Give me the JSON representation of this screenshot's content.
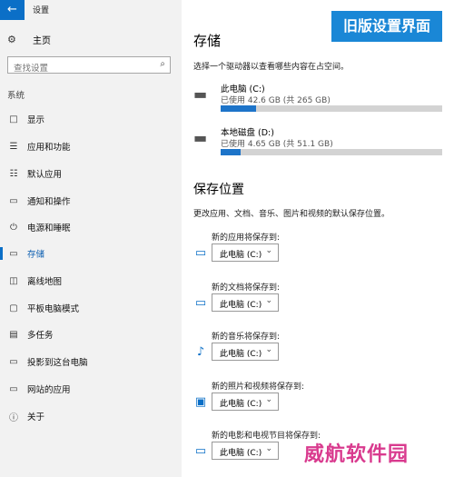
{
  "window": {
    "back_icon": "←",
    "title": "设置"
  },
  "sidebar": {
    "home": {
      "icon": "⚙",
      "label": "主页"
    },
    "search": {
      "placeholder": "查找设置",
      "icon": "⌕"
    },
    "section_label": "系统",
    "items": [
      {
        "icon": "□",
        "label": "显示"
      },
      {
        "icon": "☰",
        "label": "应用和功能"
      },
      {
        "icon": "☷",
        "label": "默认应用"
      },
      {
        "icon": "▭",
        "label": "通知和操作"
      },
      {
        "icon": "⏻",
        "label": "电源和睡眠"
      },
      {
        "icon": "▭",
        "label": "存储"
      },
      {
        "icon": "◫",
        "label": "离线地图"
      },
      {
        "icon": "▢",
        "label": "平板电脑模式"
      },
      {
        "icon": "▤",
        "label": "多任务"
      },
      {
        "icon": "▭",
        "label": "投影到这台电脑"
      },
      {
        "icon": "▭",
        "label": "网站的应用"
      },
      {
        "icon": "ⓘ",
        "label": "关于"
      }
    ],
    "active_index": 5
  },
  "main": {
    "storage": {
      "title": "存储",
      "description": "选择一个驱动器以查看哪些内容在占空间。",
      "drives": [
        {
          "icon": "▬",
          "name": "此电脑 (C:)",
          "usage": "已使用 42.6 GB (共 265 GB)",
          "fraction_used": 0.161
        },
        {
          "icon": "▬",
          "name": "本地磁盘 (D:)",
          "usage": "已使用 4.65 GB (共 51.1 GB)",
          "fraction_used": 0.091
        }
      ]
    },
    "save_locations": {
      "title": "保存位置",
      "description": "更改应用、文档、音乐、图片和视频的默认保存位置。",
      "items": [
        {
          "icon": "▭",
          "label": "新的应用将保存到:",
          "value": "此电脑 (C:)"
        },
        {
          "icon": "▭",
          "label": "新的文档将保存到:",
          "value": "此电脑 (C:)"
        },
        {
          "icon": "♪",
          "label": "新的音乐将保存到:",
          "value": "此电脑 (C:)"
        },
        {
          "icon": "▣",
          "label": "新的照片和视频将保存到:",
          "value": "此电脑 (C:)"
        },
        {
          "icon": "▭",
          "label": "新的电影和电视节目将保存到:",
          "value": "此电脑 (C:)"
        }
      ],
      "chevron": "⌄"
    }
  },
  "overlay": {
    "banner": "旧版设置界面",
    "watermark": "威航软件园"
  },
  "colors": {
    "accent": "#0b6fc7",
    "bar_fill": "#1d74c9",
    "banner_bg": "#1a87d6",
    "watermark": "#d93a8e"
  }
}
